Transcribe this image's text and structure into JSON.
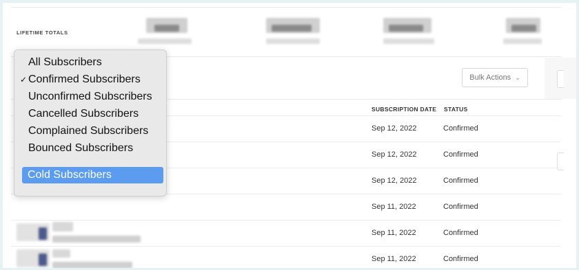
{
  "summary": {
    "lifetime_totals_label": "LIFETIME TOTALS"
  },
  "toolbar": {
    "bulk_actions_label": "Bulk Actions",
    "bulk_actions_icon": "chevron-down-icon"
  },
  "table": {
    "columns": {
      "subscription_date": "SUBSCRIPTION DATE",
      "status": "STATUS"
    },
    "rows": [
      {
        "date": "Sep 12, 2022",
        "status": "Confirmed"
      },
      {
        "date": "Sep 12, 2022",
        "status": "Confirmed"
      },
      {
        "date": "Sep 12, 2022",
        "status": "Confirmed"
      },
      {
        "date": "Sep 11, 2022",
        "status": "Confirmed"
      },
      {
        "date": "Sep 11, 2022",
        "status": "Confirmed"
      },
      {
        "date": "Sep 11, 2022",
        "status": "Confirmed"
      }
    ]
  },
  "filter_dropdown": {
    "items": [
      "All Subscribers",
      "Confirmed Subscribers",
      "Unconfirmed Subscribers",
      "Cancelled Subscribers",
      "Complained Subscribers",
      "Bounced Subscribers"
    ],
    "checked_item": "Confirmed Subscribers",
    "highlighted_item": "Cold Subscribers",
    "check_mark": "✓",
    "highlight_color": "#5b9cf0"
  }
}
